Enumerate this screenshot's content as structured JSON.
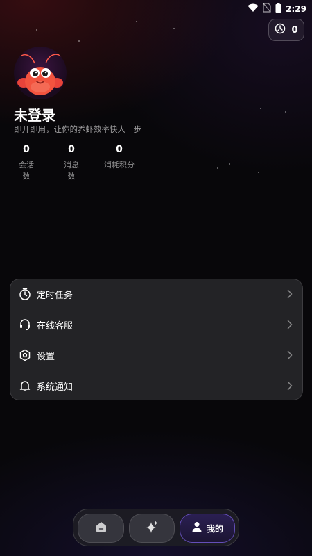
{
  "status_bar": {
    "time": "2:29"
  },
  "points": {
    "value": "0",
    "icon": "points-icon"
  },
  "profile": {
    "name": "未登录",
    "tagline": "即开即用，让你的养虾效率快人一步",
    "avatar_icon": "lobster-avatar"
  },
  "stats": [
    {
      "value": "0",
      "label": "会话数"
    },
    {
      "value": "0",
      "label": "消息数"
    },
    {
      "value": "0",
      "label": "消耗积分"
    }
  ],
  "menu": [
    {
      "label": "定时任务",
      "icon": "timer-icon"
    },
    {
      "label": "在线客服",
      "icon": "headset-icon"
    },
    {
      "label": "设置",
      "icon": "settings-icon"
    },
    {
      "label": "系统通知",
      "icon": "bell-icon"
    }
  ],
  "bottom_nav": {
    "home_icon": "home-icon",
    "explore_icon": "sparkle-icon",
    "me_label": "我的",
    "me_icon": "user-icon"
  },
  "colors": {
    "accent": "#7a5cff",
    "background": "#08070a"
  }
}
